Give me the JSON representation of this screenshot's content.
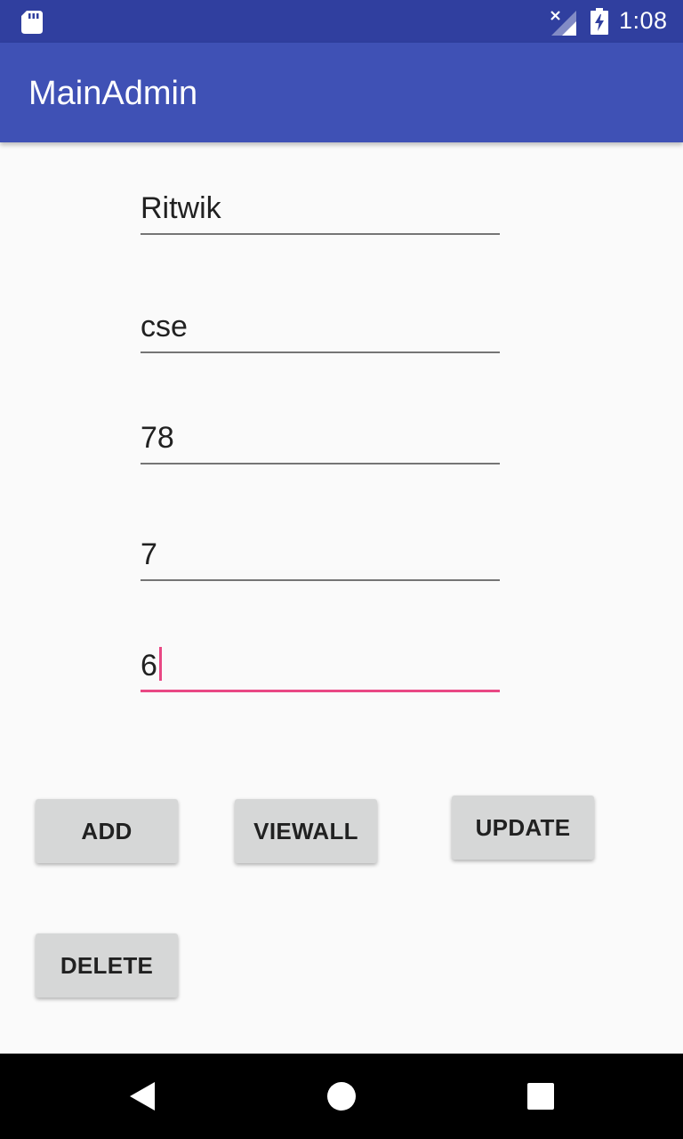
{
  "status_bar": {
    "time": "1:08",
    "icons": [
      "sd-card-icon",
      "signal-no-data-icon",
      "battery-charging-icon"
    ]
  },
  "app_bar": {
    "title": "MainAdmin",
    "color": "#3f51b5"
  },
  "form": {
    "fields": [
      {
        "value": "Ritwik"
      },
      {
        "value": "cse"
      },
      {
        "value": "78"
      },
      {
        "value": "7"
      },
      {
        "value": "6"
      }
    ],
    "accent": "#e94884"
  },
  "buttons": {
    "add": "ADD",
    "viewall": "VIEWALL",
    "update": "UPDATE",
    "delete": "DELETE"
  },
  "nav_bar": {
    "icons": [
      "back-icon",
      "home-icon",
      "recents-icon"
    ]
  }
}
